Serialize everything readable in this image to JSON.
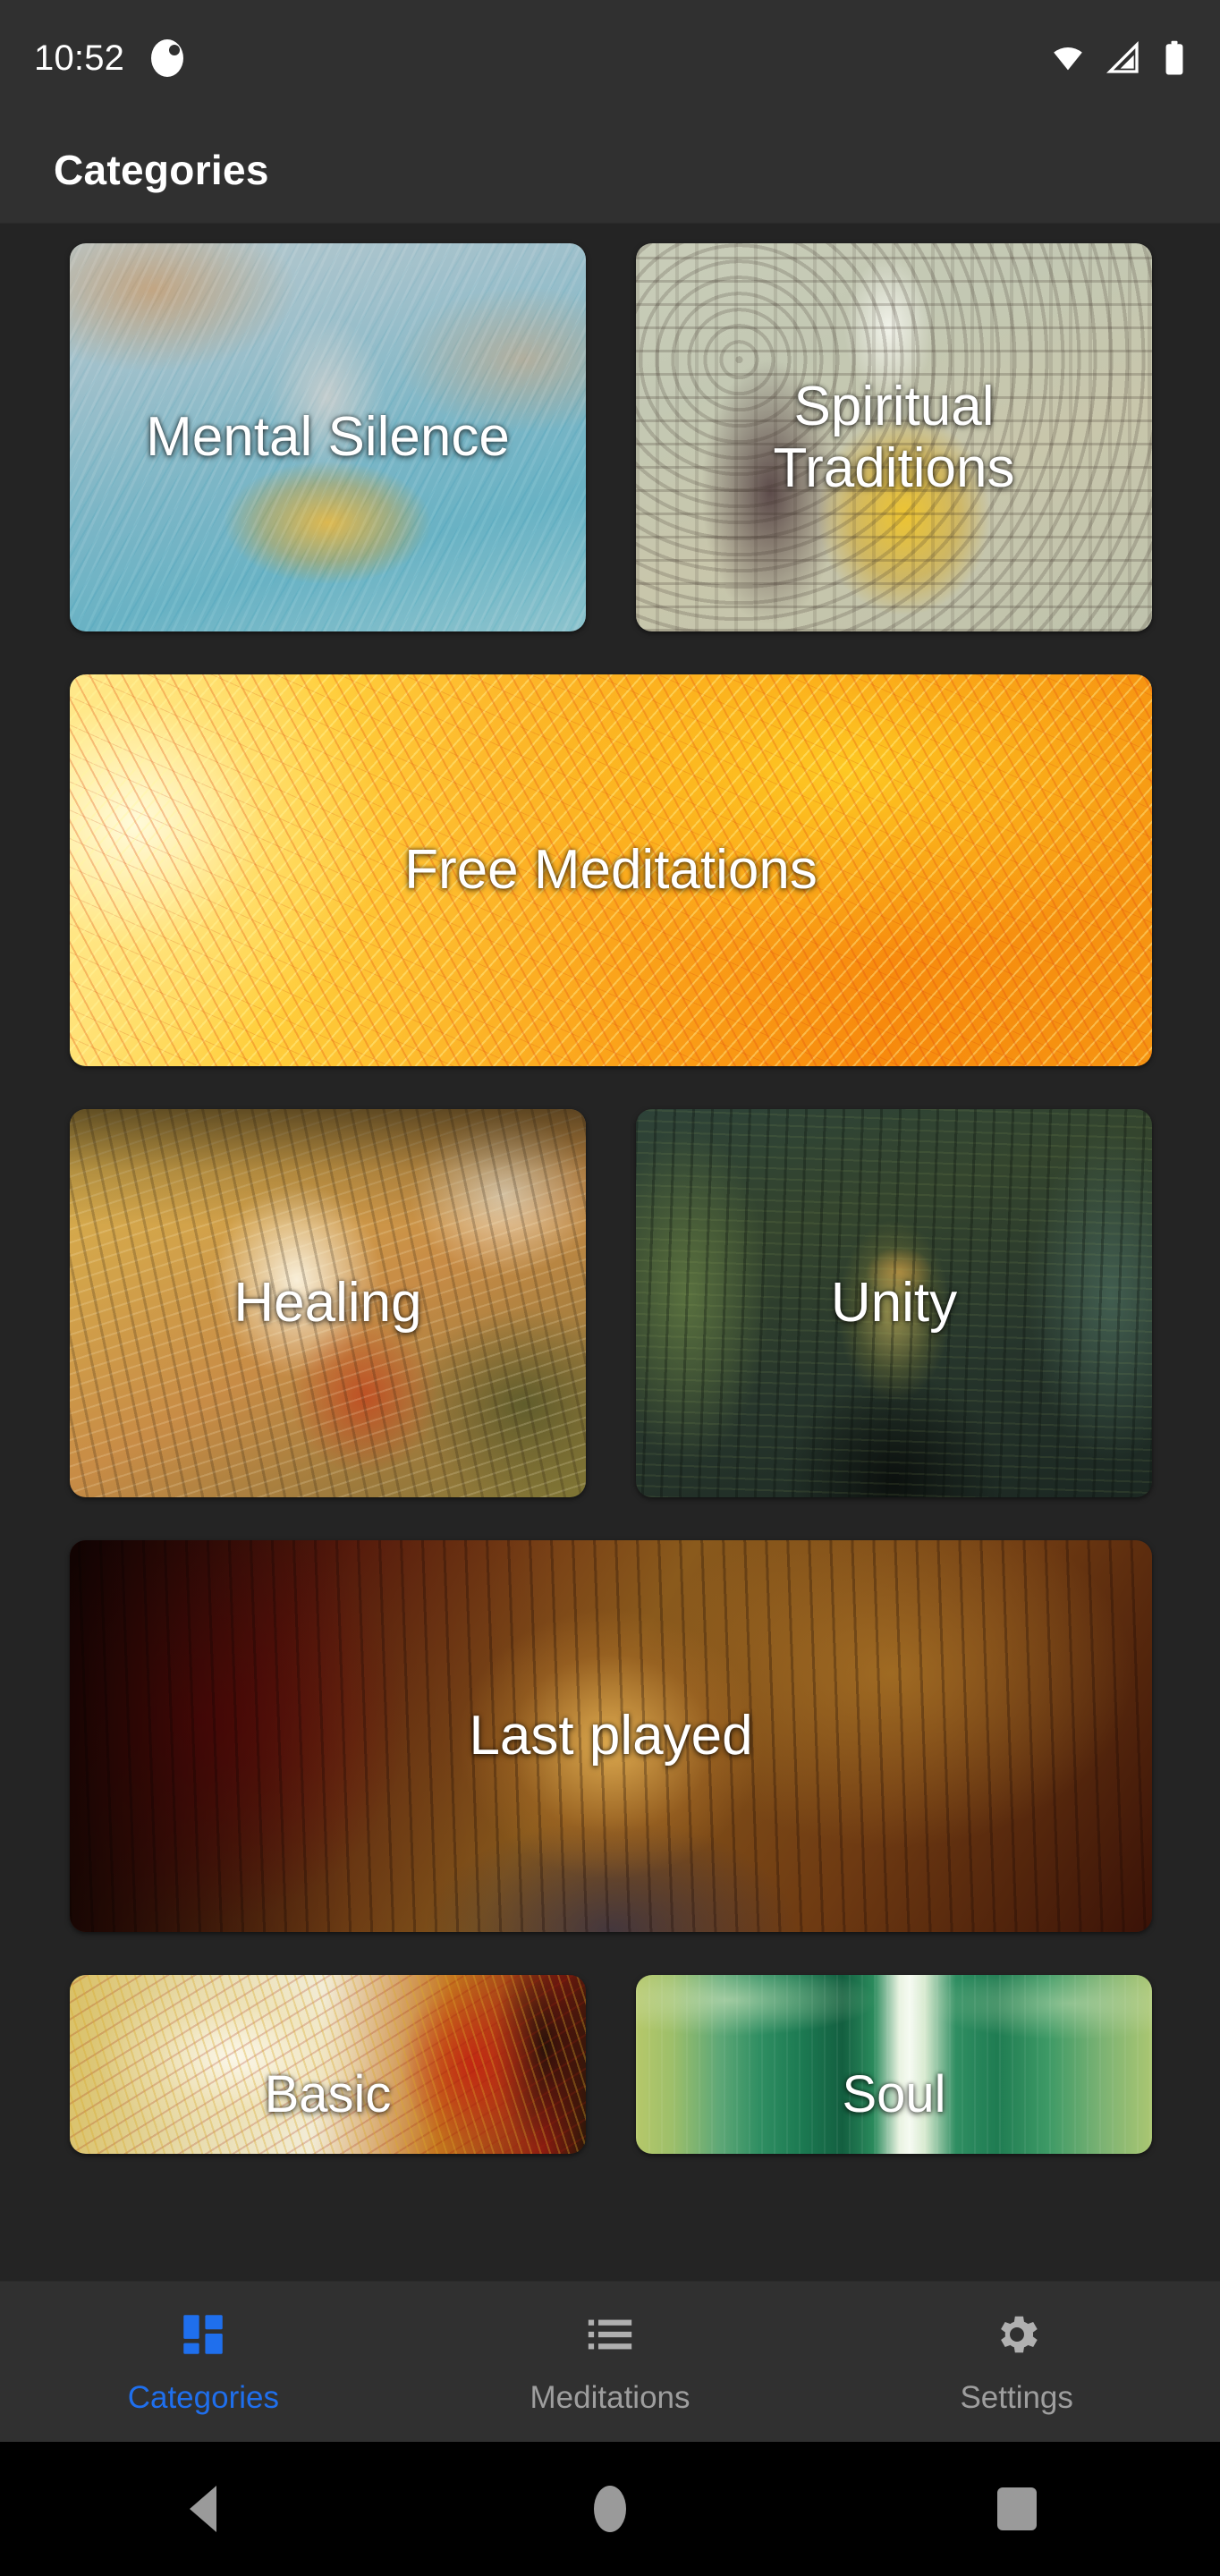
{
  "status_bar": {
    "clock": "10:52",
    "icons": [
      "notification-dot-icon",
      "wifi-icon",
      "cellular-signal-icon",
      "battery-icon"
    ]
  },
  "app_bar": {
    "title": "Categories"
  },
  "categories": [
    {
      "label": "Mental Silence",
      "art": "art-mental",
      "span": "half",
      "cut": false
    },
    {
      "label": "Spiritual\nTraditions",
      "art": "art-spiritual",
      "span": "half",
      "cut": false
    },
    {
      "label": "Free Meditations",
      "art": "art-free",
      "span": "wide",
      "cut": false
    },
    {
      "label": "Healing",
      "art": "art-healing",
      "span": "half",
      "cut": false
    },
    {
      "label": "Unity",
      "art": "art-unity",
      "span": "half",
      "cut": false
    },
    {
      "label": "Last played",
      "art": "art-last",
      "span": "wide",
      "cut": false
    },
    {
      "label": "Basic",
      "art": "art-basic",
      "span": "half",
      "cut": true
    },
    {
      "label": "Soul",
      "art": "art-soul",
      "span": "half",
      "cut": true
    }
  ],
  "labels": {
    "mental_silence": "Mental Silence",
    "spiritual_line1": "Spiritual",
    "spiritual_line2": "Traditions",
    "free_meditations": "Free Meditations",
    "healing": "Healing",
    "unity": "Unity",
    "last_played": "Last played",
    "basic": "Basic",
    "soul": "Soul"
  },
  "tab_bar": {
    "active_index": 0,
    "items": [
      {
        "label": "Categories",
        "icon": "dashboard-grid-icon"
      },
      {
        "label": "Meditations",
        "icon": "list-icon"
      },
      {
        "label": "Settings",
        "icon": "gear-icon"
      }
    ]
  },
  "system_nav": {
    "buttons": [
      {
        "name": "back-button",
        "icon": "triangle-back-icon"
      },
      {
        "name": "home-button",
        "icon": "circle-home-icon"
      },
      {
        "name": "recents-button",
        "icon": "square-recents-icon"
      }
    ]
  },
  "colors": {
    "accent": "#1f6fed",
    "bar_background": "#303030",
    "content_background": "#242424",
    "system_nav_background": "#000000",
    "inactive_tab": "#9e9e9e"
  }
}
